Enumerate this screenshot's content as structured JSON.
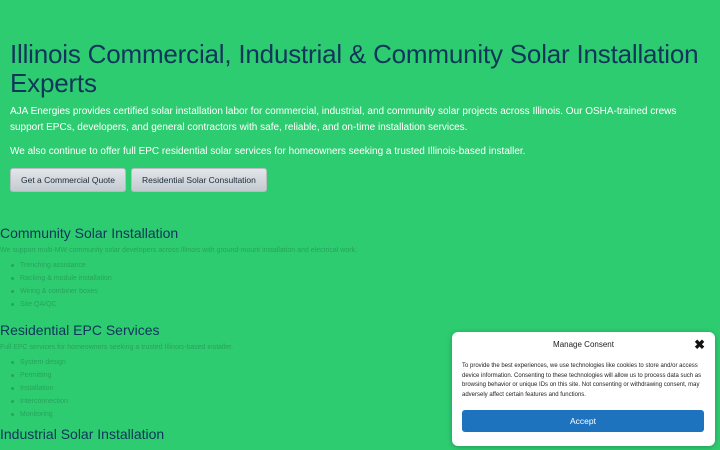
{
  "hero": {
    "title": "Illinois Commercial, Industrial & Community Solar Installation Experts",
    "paragraph1": "AJA Energies provides certified solar installation labor for commercial, industrial, and community solar projects across Illinois. Our OSHA-trained crews support EPCs, developers, and general contractors with safe, reliable, and on-time installation services.",
    "paragraph2": "We also continue to offer full EPC residential solar services for homeowners seeking a trusted Illinois-based installer.",
    "button_quote": "Get a Commercial Quote",
    "button_consult": "Residential Solar Consultation"
  },
  "sections": {
    "community": {
      "title": "Community Solar Installation",
      "description": "We support multi-MW community solar developers across Illinois with ground-mount installation and electrical work.",
      "items": [
        "Trenching assistance",
        "Racking & module installation",
        "Wiring & combiner boxes",
        "Site QA/QC"
      ]
    },
    "residential": {
      "title": "Residential EPC Services",
      "description": "Full EPC services for homeowners seeking a trusted Illinois-based installer.",
      "items": [
        "System design",
        "Permitting",
        "Installation",
        "Interconnection",
        "Monitoring"
      ]
    },
    "industrial": {
      "title": "Industrial Solar Installation"
    }
  },
  "consent": {
    "title": "Manage Consent",
    "body": "To provide the best experiences, we use technologies like cookies to store and/or access device information. Consenting to these technologies will allow us to process data such as browsing behavior or unique IDs on this site. Not consenting or withdrawing consent, may adversely affect certain features and functions.",
    "close_glyph": "✖",
    "accept_label": "Accept"
  },
  "colors": {
    "background": "#2ecc71",
    "heading": "#10365a",
    "accept_button": "#1e73be"
  }
}
